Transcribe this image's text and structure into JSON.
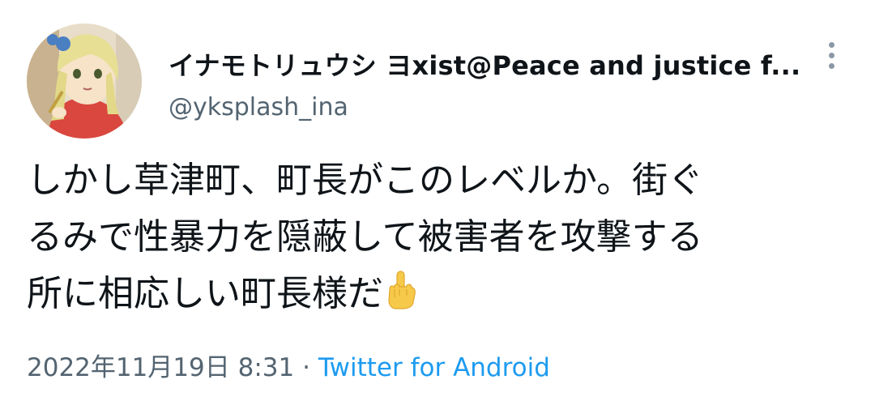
{
  "author": {
    "display_name": "イナモトリュウシ ヨxist@Peace and justice f...",
    "handle": "@yksplash_ina"
  },
  "tweet": {
    "lines": [
      "しかし草津町、町長がこのレベルか。街ぐ",
      "るみで性暴力を隠蔽して被害者を攻撃する",
      "所に相応しい町長様だ"
    ],
    "emoji": "middle-finger-emoji"
  },
  "meta": {
    "timestamp": "2022年11月19日 8:31",
    "separator": "·",
    "source": "Twitter for Android"
  },
  "colors": {
    "text": "#0f1419",
    "secondary": "#536471",
    "link": "#1d9bf0"
  }
}
